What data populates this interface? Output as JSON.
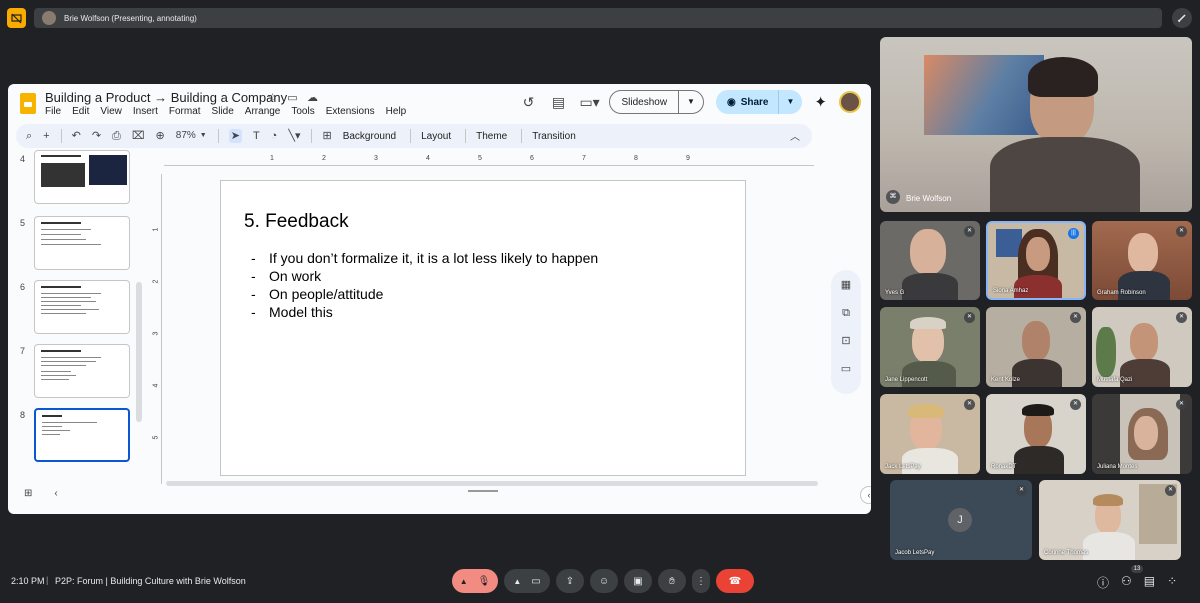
{
  "presenter_bar": {
    "text": "Brie Wolfson (Presenting, annotating)",
    "icon": "presenting-icon",
    "annotate_icon": "pen-icon"
  },
  "slides_app": {
    "doc_title": "Building a Product → Building a Company",
    "menu": [
      "File",
      "Edit",
      "View",
      "Insert",
      "Format",
      "Slide",
      "Arrange",
      "Tools",
      "Extensions",
      "Help"
    ],
    "slideshow_label": "Slideshow",
    "share_label": "Share",
    "zoom": "87%",
    "toolbar_text": {
      "background": "Background",
      "layout": "Layout",
      "theme": "Theme",
      "transition": "Transition"
    },
    "ruler_top": [
      "1",
      "2",
      "3",
      "4",
      "5",
      "6",
      "7",
      "8",
      "9"
    ],
    "ruler_left": [
      "1",
      "2",
      "3",
      "4",
      "5"
    ],
    "thumbnails": [
      {
        "num": "4"
      },
      {
        "num": "5"
      },
      {
        "num": "6"
      },
      {
        "num": "7"
      },
      {
        "num": "8",
        "selected": true
      }
    ],
    "slide": {
      "title": "5. Feedback",
      "bullets": [
        "If you don’t formalize it, it is a lot less likely to happen",
        "On work",
        "On people/attitude",
        "Model this"
      ]
    }
  },
  "participants": {
    "main": "Brie Wolfson",
    "tiles": [
      {
        "name": "Yves G",
        "speaking": false
      },
      {
        "name": "Siona Amhaz",
        "speaking": true
      },
      {
        "name": "Graham Robinson",
        "speaking": false
      },
      {
        "name": "Jane Lippencott",
        "speaking": false
      },
      {
        "name": "Kent Kolze",
        "speaking": false
      },
      {
        "name": "Mustafa Qazi",
        "speaking": false
      },
      {
        "name": "Jack LetsPay",
        "speaking": false
      },
      {
        "name": "RonakDT",
        "speaking": false
      },
      {
        "name": "Juliana Montes",
        "speaking": false
      },
      {
        "name": "Jacob LetsPay",
        "speaking": false,
        "initial": "J"
      },
      {
        "name": "Corinne Thomas",
        "speaking": false
      }
    ]
  },
  "bottom_bar": {
    "time": "2:10 PM",
    "separator": "|",
    "meeting_title": "P2P: Forum | Building Culture with Brie Wolfson",
    "people_count": "13"
  },
  "colors": {
    "accent": "#0b57d0",
    "share_bg": "#c2e7ff",
    "hangup": "#ea4335",
    "presenting": "#f9ab00"
  }
}
